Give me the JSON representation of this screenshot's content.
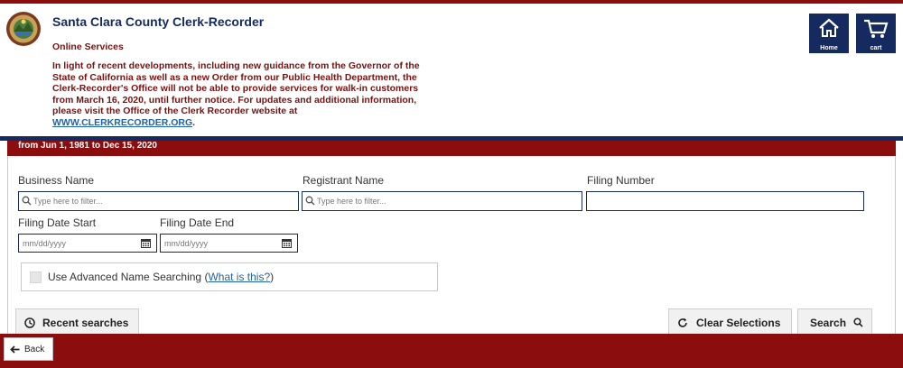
{
  "header": {
    "title": "Santa Clara County Clerk-Recorder",
    "subtitle": "Online Services",
    "notice_text": "In light of recent developments, including new guidance from the Governor of the State of California as well as a new Order from our Public Health Department, the Clerk-Recorder's Office will not be able to provide services for walk-in customers from March 16, 2020, until further notice.  For updates and additional information, please visit the Office of the Clerk Recorder website at",
    "notice_link": "WWW.CLERKRECORDER.ORG",
    "notice_end": ".",
    "home_label": "Home",
    "cart_label": "cart"
  },
  "panel": {
    "date_range": "from Jun 1, 1981 to Dec 15, 2020"
  },
  "form": {
    "business_name_label": "Business Name",
    "business_name_placeholder": "Type here to filter...",
    "registrant_name_label": "Registrant Name",
    "registrant_name_placeholder": "Type here to filter...",
    "filing_number_label": "Filing Number",
    "filing_number_value": "",
    "filing_date_start_label": "Filing Date Start",
    "filing_date_start_placeholder": "mm/dd/yyyy",
    "filing_date_end_label": "Filing Date End",
    "filing_date_end_placeholder": "mm/dd/yyyy",
    "advanced_label": "Use Advanced Name Searching",
    "advanced_link": "What is this?"
  },
  "buttons": {
    "recent_searches": "Recent searches",
    "clear_selections": "Clear Selections",
    "search": "Search",
    "back": "Back"
  },
  "colors": {
    "brand_red": "#8b0d0d",
    "brand_navy": "#152a5e",
    "link_blue": "#1f63a8"
  },
  "icons": {
    "seal": "county-seal-icon",
    "home": "home-icon",
    "cart": "cart-icon",
    "search": "search-icon",
    "calendar": "calendar-icon",
    "clock": "clock-icon",
    "refresh": "refresh-icon",
    "arrow_left": "arrow-left-icon"
  }
}
